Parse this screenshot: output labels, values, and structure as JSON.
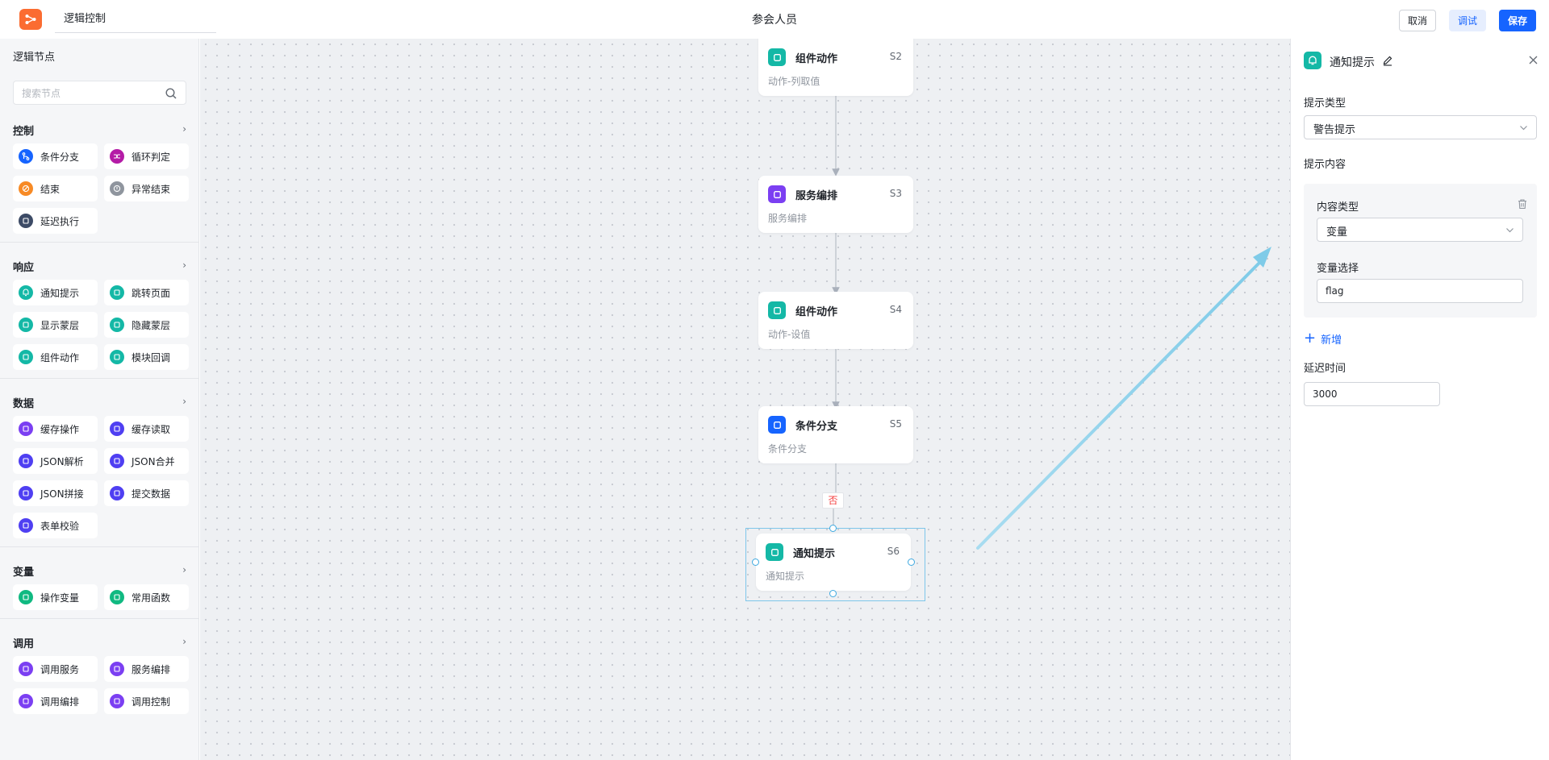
{
  "header": {
    "tab_label": "逻辑控制",
    "page_title": "参会人员",
    "cancel_label": "取消",
    "debug_label": "调试",
    "save_label": "保存"
  },
  "sidebar": {
    "title": "逻辑节点",
    "search_placeholder": "搜索节点",
    "sections": [
      {
        "title": "控制",
        "items": [
          {
            "label": "条件分支",
            "color": "#1664ff",
            "icon": "branch-icon"
          },
          {
            "label": "循环判定",
            "color": "#b41ba6",
            "icon": "loop-icon"
          },
          {
            "label": "结束",
            "color": "#f78a25",
            "icon": "end-icon"
          },
          {
            "label": "异常结束",
            "color": "#8f959e",
            "icon": "error-end-icon"
          },
          {
            "label": "延迟执行",
            "color": "#3d4b66",
            "icon": "delay-icon"
          }
        ]
      },
      {
        "title": "响应",
        "items": [
          {
            "label": "通知提示",
            "color": "#14b8a6",
            "icon": "bell-icon"
          },
          {
            "label": "跳转页面",
            "color": "#14b8a6",
            "icon": "jump-page-icon"
          },
          {
            "label": "显示蒙层",
            "color": "#14b8a6",
            "icon": "show-mask-icon"
          },
          {
            "label": "隐藏蒙层",
            "color": "#14b8a6",
            "icon": "hide-mask-icon"
          },
          {
            "label": "组件动作",
            "color": "#14b8a6",
            "icon": "component-action-icon"
          },
          {
            "label": "模块回调",
            "color": "#14b8a6",
            "icon": "module-callback-icon"
          }
        ]
      },
      {
        "title": "数据",
        "items": [
          {
            "label": "缓存操作",
            "color": "#7b3ff2",
            "icon": "cache-op-icon"
          },
          {
            "label": "缓存读取",
            "color": "#4f3ff2",
            "icon": "cache-read-icon"
          },
          {
            "label": "JSON解析",
            "color": "#4f3ff2",
            "icon": "json-parse-icon"
          },
          {
            "label": "JSON合并",
            "color": "#4f3ff2",
            "icon": "json-merge-icon"
          },
          {
            "label": "JSON拼接",
            "color": "#4f3ff2",
            "icon": "json-concat-icon"
          },
          {
            "label": "提交数据",
            "color": "#4f3ff2",
            "icon": "submit-data-icon"
          },
          {
            "label": "表单校验",
            "color": "#4f3ff2",
            "icon": "form-validate-icon"
          }
        ]
      },
      {
        "title": "变量",
        "items": [
          {
            "label": "操作变量",
            "color": "#10b981",
            "icon": "variable-icon"
          },
          {
            "label": "常用函数",
            "color": "#10b981",
            "icon": "function-icon"
          }
        ]
      },
      {
        "title": "调用",
        "items": [
          {
            "label": "调用服务",
            "color": "#7b3ff2",
            "icon": "call-service-icon"
          },
          {
            "label": "服务编排",
            "color": "#7b3ff2",
            "icon": "service-orchestration-icon"
          },
          {
            "label": "调用编排",
            "color": "#7b3ff2",
            "icon": "call-orchestration-icon"
          },
          {
            "label": "调用控制",
            "color": "#7b3ff2",
            "icon": "call-control-icon"
          }
        ]
      }
    ]
  },
  "flow": {
    "nodes": [
      {
        "name": "组件动作",
        "code": "S2",
        "desc": "动作-列取值",
        "color": "#14b8a6",
        "icon": "component-action-icon"
      },
      {
        "name": "服务编排",
        "code": "S3",
        "desc": "服务编排",
        "color": "#7b3ff2",
        "icon": "service-orchestration-icon"
      },
      {
        "name": "组件动作",
        "code": "S4",
        "desc": "动作-设值",
        "color": "#14b8a6",
        "icon": "component-action-icon"
      },
      {
        "name": "条件分支",
        "code": "S5",
        "desc": "条件分支",
        "color": "#1664ff",
        "icon": "branch-icon"
      },
      {
        "name": "通知提示",
        "code": "S6",
        "desc": "通知提示",
        "color": "#14b8a6",
        "icon": "bell-icon"
      }
    ],
    "branch_label": "否"
  },
  "panel": {
    "title": "通知提示",
    "type_label": "提示类型",
    "type_value": "警告提示",
    "content_label": "提示内容",
    "content_type_label": "内容类型",
    "content_type_value": "变量",
    "variable_label": "变量选择",
    "variable_value": "flag",
    "add_label": "新增",
    "delay_label": "延迟时间",
    "delay_value": "3000"
  }
}
